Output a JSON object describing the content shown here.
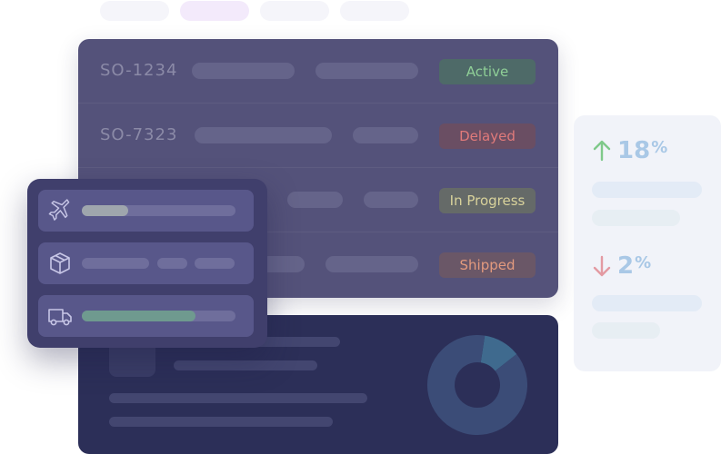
{
  "filters": [
    {
      "name": "filter-pill-1",
      "active": false
    },
    {
      "name": "filter-pill-2",
      "active": true
    },
    {
      "name": "filter-pill-3",
      "active": false
    },
    {
      "name": "filter-pill-4",
      "active": false
    }
  ],
  "orders": [
    {
      "id": "SO-1234",
      "status": "Active",
      "status_color": "#8fcf97",
      "status_bg": "#4e6a68"
    },
    {
      "id": "SO-7323",
      "status": "Delayed",
      "status_color": "#e07a7a",
      "status_bg": "#6a4e63"
    },
    {
      "id": "",
      "status": "In Progress",
      "status_color": "#d8d29b",
      "status_bg": "#656a68"
    },
    {
      "id": "",
      "status": "Shipped",
      "status_color": "#e39a7e",
      "status_bg": "#6a5767"
    }
  ],
  "kpis": [
    {
      "value": "18",
      "unit": "%",
      "direction": "up",
      "arrow_color": "#7fc98a"
    },
    {
      "value": "2",
      "unit": "%",
      "direction": "down",
      "arrow_color": "#e39aa2"
    }
  ],
  "shipping_methods": [
    {
      "icon": "airplane-icon",
      "progress": 0.3,
      "fill_color": "#9fa6ad"
    },
    {
      "icon": "package-icon",
      "progress": null,
      "fill_color": ""
    },
    {
      "icon": "truck-icon",
      "progress": 0.74,
      "fill_color": "#6f9a8f"
    }
  ],
  "donut": {
    "segments": [
      0.12,
      0.88
    ],
    "colors": [
      "#3f6a8e",
      "#3b4c77"
    ]
  }
}
